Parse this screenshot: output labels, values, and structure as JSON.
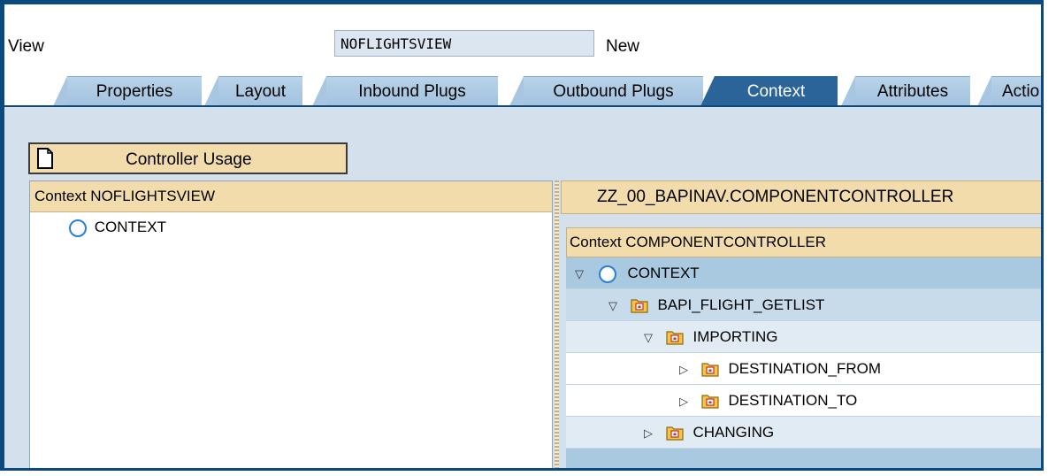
{
  "header": {
    "view_label": "View",
    "view_name": "NOFLIGHTSVIEW",
    "view_status": "New"
  },
  "tabs": [
    {
      "label": "Properties",
      "active": false
    },
    {
      "label": "Layout",
      "active": false
    },
    {
      "label": "Inbound Plugs",
      "active": false
    },
    {
      "label": "Outbound Plugs",
      "active": false
    },
    {
      "label": "Context",
      "active": true
    },
    {
      "label": "Attributes",
      "active": false
    },
    {
      "label": "Actio",
      "active": false
    }
  ],
  "toolbar": {
    "controller_usage_label": "Controller Usage"
  },
  "left_panel": {
    "header": "Context NOFLIGHTSVIEW",
    "root_node": "CONTEXT"
  },
  "right_panel": {
    "header": "ZZ_00_BAPINAV.COMPONENTCONTROLLER",
    "tree_header": "Context COMPONENTCONTROLLER",
    "nodes": {
      "context": "CONTEXT",
      "bapi": "BAPI_FLIGHT_GETLIST",
      "importing": "IMPORTING",
      "dest_from": "DESTINATION_FROM",
      "dest_to": "DESTINATION_TO",
      "changing": "CHANGING"
    }
  },
  "colors": {
    "frame_border": "#0c4a7e",
    "active_tab": "#2a6498",
    "inactive_tab": "#a8c6e1",
    "panel_header": "#f2dcab",
    "content_bg": "#d4e0ec"
  }
}
